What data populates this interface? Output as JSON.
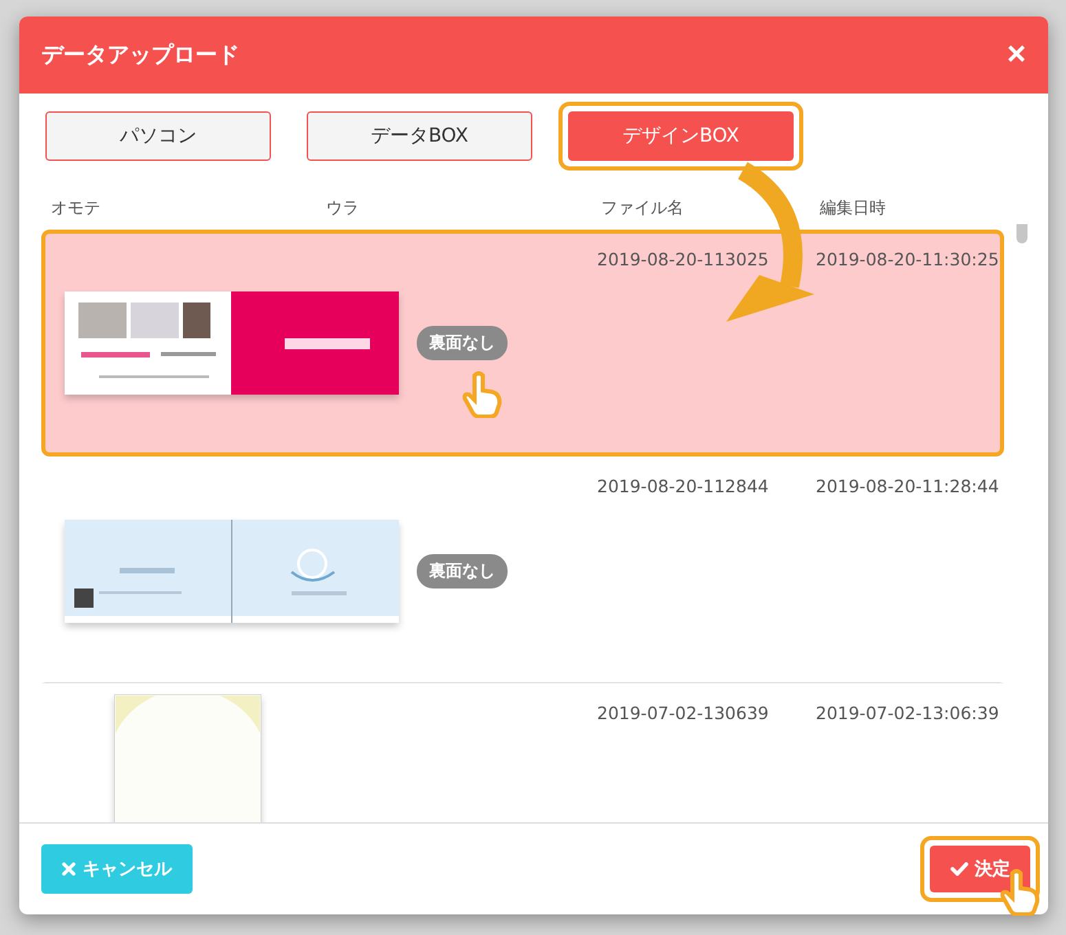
{
  "dialog": {
    "title": "データアップロード",
    "close": "×"
  },
  "source_tabs": [
    {
      "label": "パソコン",
      "selected": false,
      "highlighted": false
    },
    {
      "label": "データBOX",
      "selected": false,
      "highlighted": false
    },
    {
      "label": "デザインBOX",
      "selected": true,
      "highlighted": true
    }
  ],
  "table": {
    "columns": [
      "オモテ",
      "ウラ",
      "ファイル名",
      "編集日時"
    ],
    "rows": [
      {
        "selected": true,
        "back": "裏面なし",
        "file": "2019-08-20-113025",
        "modified": "2019-08-20-11:30:25"
      },
      {
        "selected": false,
        "back": "裏面なし",
        "file": "2019-08-20-112844",
        "modified": "2019-08-20-11:28:44"
      },
      {
        "selected": false,
        "file": "2019-07-02-130639",
        "modified": "2019-07-02-13:06:39"
      }
    ]
  },
  "footer": {
    "cancel": {
      "label": "キャンセル",
      "highlighted": false
    },
    "confirm": {
      "label": "決定",
      "highlighted": true
    }
  }
}
